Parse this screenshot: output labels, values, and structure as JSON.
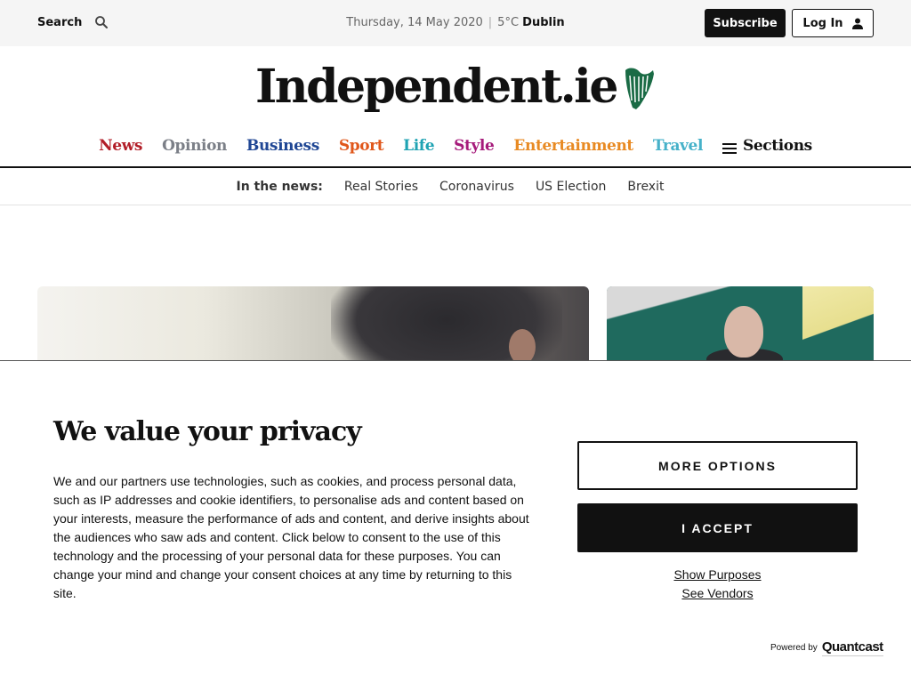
{
  "topbar": {
    "search_label": "Search",
    "date": "Thursday, 14 May 2020",
    "temperature": "5°C",
    "city": "Dublin",
    "subscribe_label": "Subscribe",
    "login_label": "Log In"
  },
  "masthead": {
    "logo_text": "Independent.ie",
    "logo_color": "#1a6b45"
  },
  "sections": [
    {
      "label": "News",
      "color": "#b21e28"
    },
    {
      "label": "Opinion",
      "color": "#7b7f87"
    },
    {
      "label": "Business",
      "color": "#1f4694"
    },
    {
      "label": "Sport",
      "color": "#e0571b"
    },
    {
      "label": "Life",
      "color": "#1fa3b3"
    },
    {
      "label": "Style",
      "color": "#a61b7b"
    },
    {
      "label": "Entertainment",
      "color": "#e88a23"
    },
    {
      "label": "Travel",
      "color": "#46b1c9"
    }
  ],
  "sections_menu_label": "Sections",
  "in_the_news": {
    "label": "In the news:",
    "items": [
      "Real Stories",
      "Coronavirus",
      "US Election",
      "Brexit"
    ]
  },
  "privacy": {
    "title": "We value your privacy",
    "body": "We and our partners use technologies, such as cookies, and process personal data, such as IP addresses and cookie identifiers, to personalise ads and content based on your interests, measure the performance of ads and content, and derive insights about the audiences who saw ads and content. Click below to consent to the use of this technology and the processing of your personal data for these purposes. You can change your mind and change your consent choices at any time by returning to this site.",
    "more_options_label": "MORE OPTIONS",
    "accept_label": "I ACCEPT",
    "show_purposes_label": "Show Purposes",
    "see_vendors_label": "See Vendors",
    "powered_by_label": "Powered by",
    "powered_by_brand": "Quantcast"
  }
}
